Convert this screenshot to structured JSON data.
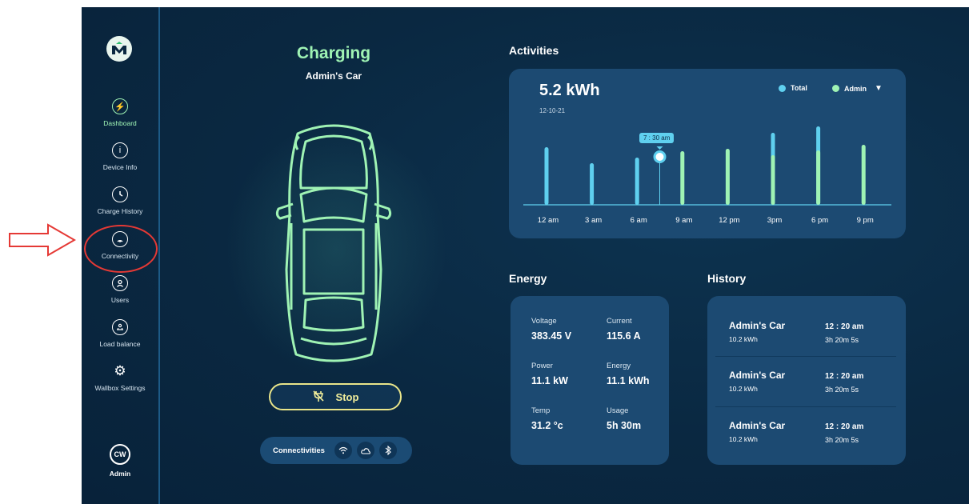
{
  "sidebar": {
    "items": [
      {
        "label": "Dashboard",
        "icon": "bolt-icon",
        "active": true
      },
      {
        "label": "Device Info",
        "icon": "info-icon",
        "active": false
      },
      {
        "label": "Charge History",
        "icon": "clock-icon",
        "active": false
      },
      {
        "label": "Connectivity",
        "icon": "signal-icon",
        "active": false
      },
      {
        "label": "Users",
        "icon": "user-icon",
        "active": false
      },
      {
        "label": "Load balance",
        "icon": "load-balance-icon",
        "active": false
      },
      {
        "label": "Wallbox Settings",
        "icon": "gear-icon",
        "active": false
      }
    ],
    "avatar_initials": "CW",
    "user_label": "Admin"
  },
  "car_panel": {
    "status": "Charging",
    "car_name": "Admin's Car",
    "stop_label": "Stop",
    "connectivities_label": "Connectivities",
    "connectivity_icons": [
      "wifi-icon",
      "cloud-icon",
      "bluetooth-icon"
    ]
  },
  "activities": {
    "title": "Activities",
    "total_kwh": "5.2 kWh",
    "date": "12-10-21",
    "legend": [
      {
        "label": "Total",
        "color": "#5fd0ef"
      },
      {
        "label": "Admin",
        "color": "#9ff3b4"
      }
    ],
    "tooltip": "7 : 30 am"
  },
  "chart_data": {
    "type": "bar",
    "categories": [
      "12 am",
      "3 am",
      "6 am",
      "9 am",
      "12 pm",
      "3pm",
      "6 pm",
      "9 pm"
    ],
    "series": [
      {
        "name": "Total",
        "values": [
          72,
          52,
          59,
          0,
          0,
          90,
          98,
          0
        ]
      },
      {
        "name": "Admin",
        "values": [
          0,
          0,
          0,
          67,
          70,
          62,
          68,
          75
        ]
      }
    ],
    "highlight": {
      "x": "7 : 30 am",
      "value": 60
    },
    "colors": {
      "Total": "#5fd0ef",
      "Admin": "#9ff3b4"
    }
  },
  "energy": {
    "title": "Energy",
    "metrics": [
      {
        "label": "Voltage",
        "value": "383.45 V"
      },
      {
        "label": "Current",
        "value": "115.6 A"
      },
      {
        "label": "Power",
        "value": "11.1 kW"
      },
      {
        "label": "Energy",
        "value": "11.1 kWh"
      },
      {
        "label": "Temp",
        "value": "31.2 °c"
      },
      {
        "label": "Usage",
        "value": "5h 30m"
      }
    ]
  },
  "history": {
    "title": "History",
    "entries": [
      {
        "name": "Admin's Car",
        "kwh": "10.2 kWh",
        "time": "12 : 20 am",
        "duration": "3h 20m 5s"
      },
      {
        "name": "Admin's Car",
        "kwh": "10.2 kWh",
        "time": "12 : 20 am",
        "duration": "3h 20m 5s"
      },
      {
        "name": "Admin's Car",
        "kwh": "10.2 kWh",
        "time": "12 : 20 am",
        "duration": "3h 20m 5s"
      }
    ]
  }
}
